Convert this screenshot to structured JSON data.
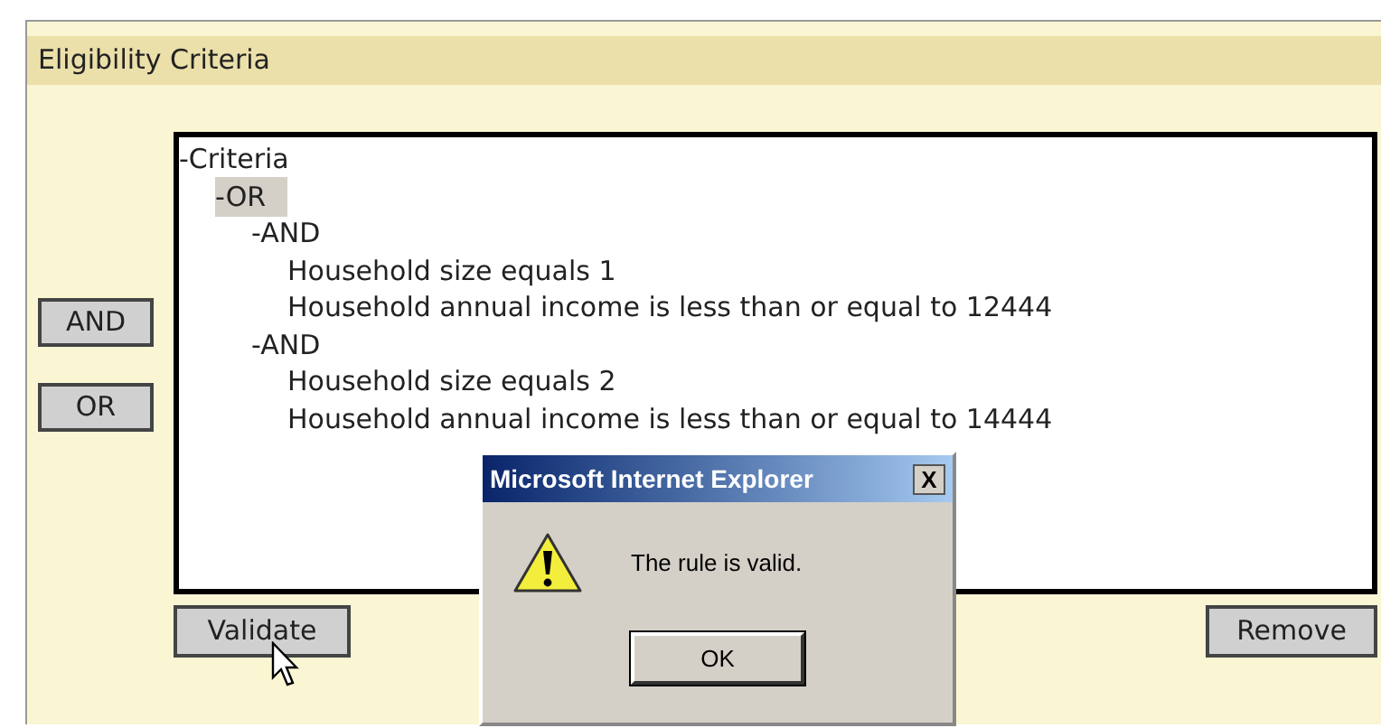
{
  "panel": {
    "title": "Eligibility Criteria"
  },
  "side_buttons": [
    "AND",
    "OR"
  ],
  "tree": [
    {
      "label": "-Criteria",
      "selected": false,
      "children": [
        {
          "label": "-OR",
          "selected": true,
          "children": [
            {
              "label": "-AND",
              "selected": false,
              "children": [
                {
                  "label": "Household size equals 1",
                  "selected": false
                },
                {
                  "label": "Household annual income is less than or equal to 12444",
                  "selected": false
                }
              ]
            },
            {
              "label": "-AND",
              "selected": false,
              "children": [
                {
                  "label": "Household size equals 2",
                  "selected": false
                },
                {
                  "label": "Household annual income is less than or equal to 14444",
                  "selected": false
                }
              ]
            }
          ]
        }
      ]
    }
  ],
  "bottom_buttons": {
    "left": "Validate",
    "right": "Remove"
  },
  "dialog": {
    "title": "Microsoft Internet Explorer",
    "close": "X",
    "message": "The rule is valid.",
    "button": "OK"
  }
}
